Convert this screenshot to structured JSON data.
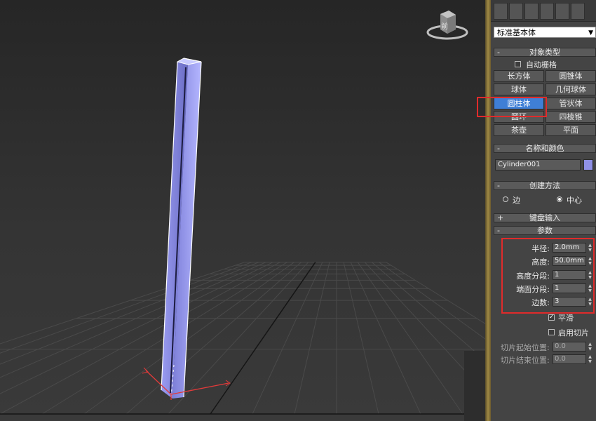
{
  "viewcube": {
    "face_label": "前"
  },
  "panel": {
    "category_dropdown": "标准基本体",
    "object_type": {
      "header": "对象类型",
      "autogrid_label": "自动栅格",
      "buttons": [
        "长方体",
        "圆锥体",
        "球体",
        "几何球体",
        "圆柱体",
        "管状体",
        "圆环",
        "四棱锥",
        "茶壶",
        "平面"
      ],
      "active_button": "圆柱体"
    },
    "name_color": {
      "header": "名称和颜色",
      "name_value": "Cylinder001",
      "color": "#8f90e6"
    },
    "creation_method": {
      "header": "创建方法",
      "options": [
        "边",
        "中心"
      ],
      "selected": "中心"
    },
    "keyboard_entry": {
      "header": "键盘输入"
    },
    "parameters": {
      "header": "参数",
      "fields": [
        {
          "label": "半径:",
          "value": "2.0mm"
        },
        {
          "label": "高度:",
          "value": "50.0mm"
        },
        {
          "label": "高度分段:",
          "value": "1"
        },
        {
          "label": "端面分段:",
          "value": "1"
        },
        {
          "label": "边数:",
          "value": "3"
        }
      ],
      "smooth_label": "平滑",
      "slice_on_label": "启用切片",
      "slice_from_label": "切片起始位置:",
      "slice_from_value": "0.0",
      "slice_to_label": "切片结束位置:",
      "slice_to_value": "0.0"
    }
  },
  "colors": {
    "highlight_red": "#e02b2b",
    "active_blue": "#3f7fd6",
    "object_color": "#8f90e6"
  }
}
